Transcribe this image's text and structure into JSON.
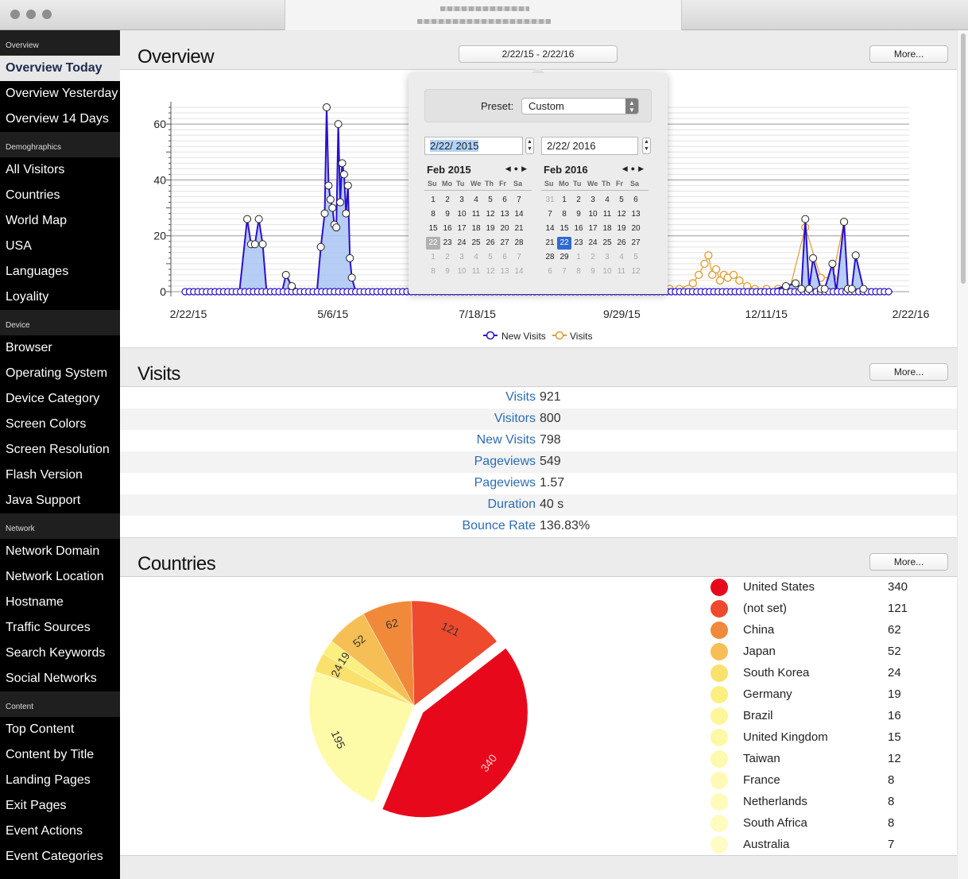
{
  "sidebar": {
    "sections": [
      {
        "title": "Overview",
        "items": [
          "Overview Today",
          "Overview Yesterday",
          "Overview 14 Days"
        ]
      },
      {
        "title": "Demoghraphics",
        "items": [
          "All Visitors",
          "Countries",
          "World Map",
          "USA",
          "Languages",
          "Loyality"
        ]
      },
      {
        "title": "Device",
        "items": [
          "Browser",
          "Operating System",
          "Device Category",
          "Screen Colors",
          "Screen Resolution",
          "Flash Version",
          "Java Support"
        ]
      },
      {
        "title": "Network",
        "items": [
          "Network Domain",
          "Network Location",
          "Hostname",
          "Traffic Sources",
          "Search Keywords",
          "Social Networks"
        ]
      },
      {
        "title": "Content",
        "items": [
          "Top Content",
          "Content by Title",
          "Landing Pages",
          "Exit Pages",
          "Event Actions",
          "Event Categories"
        ]
      }
    ],
    "active_item": "Overview Today"
  },
  "overview": {
    "title": "Overview",
    "date_range": "2/22/15 - 2/22/16",
    "more_label": "More..."
  },
  "date_popover": {
    "preset_label": "Preset:",
    "preset_value": "Custom",
    "start_date": "2/22/ 2015",
    "end_date": "2/22/ 2016",
    "calendars": [
      {
        "title": "Feb 2015",
        "weekdays": [
          "Su",
          "Mo",
          "Tu",
          "We",
          "Th",
          "Fr",
          "Sa"
        ],
        "days": [
          [
            "1",
            "2",
            "3",
            "4",
            "5",
            "6",
            "7"
          ],
          [
            "8",
            "9",
            "10",
            "11",
            "12",
            "13",
            "14"
          ],
          [
            "15",
            "16",
            "17",
            "18",
            "19",
            "20",
            "21"
          ],
          [
            "22",
            "23",
            "24",
            "25",
            "26",
            "27",
            "28"
          ],
          [
            "1",
            "2",
            "3",
            "4",
            "5",
            "6",
            "7"
          ],
          [
            "8",
            "9",
            "10",
            "11",
            "12",
            "13",
            "14"
          ]
        ],
        "outside_from": [
          4,
          0
        ],
        "highlight": "22",
        "highlight_style": "today"
      },
      {
        "title": "Feb 2016",
        "weekdays": [
          "Su",
          "Mo",
          "Tu",
          "We",
          "Th",
          "Fr",
          "Sa"
        ],
        "days": [
          [
            "31",
            "1",
            "2",
            "3",
            "4",
            "5",
            "6"
          ],
          [
            "7",
            "8",
            "9",
            "10",
            "11",
            "12",
            "13"
          ],
          [
            "14",
            "15",
            "16",
            "17",
            "18",
            "19",
            "20"
          ],
          [
            "21",
            "22",
            "23",
            "24",
            "25",
            "26",
            "27"
          ],
          [
            "28",
            "29",
            "1",
            "2",
            "3",
            "4",
            "5"
          ],
          [
            "6",
            "7",
            "8",
            "9",
            "10",
            "11",
            "12"
          ]
        ],
        "outside_before": [
          0,
          1
        ],
        "outside_from": [
          4,
          2
        ],
        "highlight": "22",
        "highlight_style": "selected"
      }
    ]
  },
  "chart_data": [
    {
      "type": "line",
      "title": "",
      "xlabel": "",
      "ylabel": "",
      "x_tick_labels": [
        "2/22/15",
        "5/6/15",
        "7/18/15",
        "9/29/15",
        "12/11/15",
        "2/22/16"
      ],
      "y_ticks": [
        0,
        20,
        40,
        60
      ],
      "ylim": [
        0,
        68
      ],
      "grid": true,
      "legend_position": "bottom-center",
      "series": [
        {
          "name": "New Visits",
          "color": "#2b10cc",
          "fill": "#a9c4f5",
          "x_day": [
            0,
            4,
            8,
            12,
            16,
            20,
            24,
            28,
            32,
            34,
            36,
            38,
            40,
            42,
            44,
            46,
            48,
            50,
            52,
            55,
            60,
            64,
            68,
            70,
            72,
            73,
            74,
            75,
            76,
            77,
            78,
            79,
            80,
            81,
            82,
            83,
            84,
            85,
            86,
            88,
            90,
            94,
            98,
            102,
            106,
            112,
            120,
            130,
            140,
            150,
            160,
            170,
            180,
            190,
            200,
            210,
            220,
            230,
            240,
            250,
            260,
            270,
            280,
            290,
            300,
            310,
            315,
            318,
            320,
            322,
            324,
            328,
            330,
            334,
            336,
            340,
            342,
            344,
            346,
            350,
            355,
            360,
            365
          ],
          "values": [
            0,
            0,
            0,
            0,
            0,
            0,
            0,
            0,
            26,
            17,
            17,
            26,
            17,
            0,
            0,
            0,
            0,
            0,
            6,
            2,
            0,
            0,
            0,
            16,
            28,
            66,
            38,
            33,
            30,
            24,
            23,
            60,
            32,
            46,
            42,
            28,
            38,
            12,
            5,
            0,
            0,
            0,
            0,
            0,
            0,
            0,
            0,
            0,
            0,
            0,
            0,
            0,
            0,
            0,
            0,
            0,
            0,
            0,
            0,
            0,
            0,
            0,
            0,
            0,
            0,
            2,
            3,
            1,
            26,
            1,
            12,
            1,
            1,
            10,
            0,
            25,
            1,
            1,
            13,
            1,
            0,
            0,
            0
          ]
        },
        {
          "name": "Visits",
          "color": "#e39a2c",
          "x_day": [
            250,
            255,
            262,
            265,
            268,
            270,
            272,
            274,
            276,
            278,
            280,
            283,
            286,
            290,
            294,
            300,
            306,
            312,
            320,
            328,
            334,
            340
          ],
          "values": [
            1,
            1,
            3,
            6,
            10,
            13,
            6,
            8,
            4,
            6,
            5,
            6,
            4,
            2,
            1,
            1,
            1,
            1,
            23,
            5,
            5,
            25
          ]
        }
      ]
    },
    {
      "type": "pie",
      "title": "",
      "slices": [
        {
          "label": "United States",
          "value": 340,
          "color": "#e8081c"
        },
        {
          "label": "(not set)",
          "value": 121,
          "color": "#ee4a2e"
        },
        {
          "label": "China",
          "value": 62,
          "color": "#f08a3a"
        },
        {
          "label": "Japan",
          "value": 52,
          "color": "#f6bf55"
        },
        {
          "label": "South Korea",
          "value": 24,
          "color": "#f9e16c"
        },
        {
          "label": "Germany",
          "value": 19,
          "color": "#fbf07f"
        },
        {
          "label": "Brazil",
          "value": 16,
          "color": "#fdf79a"
        },
        {
          "label": "United Kingdom",
          "value": 15,
          "color": "#fdf8a4"
        },
        {
          "label": "Taiwan",
          "value": 12,
          "color": "#fdf9ad"
        },
        {
          "label": "France",
          "value": 8,
          "color": "#fefab6"
        },
        {
          "label": "Netherlands",
          "value": 8,
          "color": "#fefbbb"
        },
        {
          "label": "South Africa",
          "value": 8,
          "color": "#fefbbf"
        },
        {
          "label": "Australia",
          "value": 7,
          "color": "#fefcc4"
        }
      ],
      "other_value": 195,
      "other_color": "#fefba8",
      "labeled_values": [
        "340",
        "195",
        "121",
        "62",
        "52",
        "24",
        "19"
      ]
    }
  ],
  "visits": {
    "title": "Visits",
    "more_label": "More...",
    "rows": [
      {
        "label": "Visits",
        "value": "921"
      },
      {
        "label": "Visitors",
        "value": "800"
      },
      {
        "label": "New Visits",
        "value": "798"
      },
      {
        "label": "Pageviews",
        "value": "549"
      },
      {
        "label": "Pageviews",
        "value": "1.57"
      },
      {
        "label": "Duration",
        "value": "40 s"
      },
      {
        "label": "Bounce Rate",
        "value": "136.83%"
      }
    ]
  },
  "countries": {
    "title": "Countries",
    "more_label": "More...",
    "rows": [
      {
        "name": "United States",
        "value": "340"
      },
      {
        "name": "(not set)",
        "value": "121"
      },
      {
        "name": "China",
        "value": "62"
      },
      {
        "name": "Japan",
        "value": "52"
      },
      {
        "name": "South Korea",
        "value": "24"
      },
      {
        "name": "Germany",
        "value": "19"
      },
      {
        "name": "Brazil",
        "value": "16"
      },
      {
        "name": "United Kingdom",
        "value": "15"
      },
      {
        "name": "Taiwan",
        "value": "12"
      },
      {
        "name": "France",
        "value": "8"
      },
      {
        "name": "Netherlands",
        "value": "8"
      },
      {
        "name": "South Africa",
        "value": "8"
      },
      {
        "name": "Australia",
        "value": "7"
      }
    ]
  }
}
